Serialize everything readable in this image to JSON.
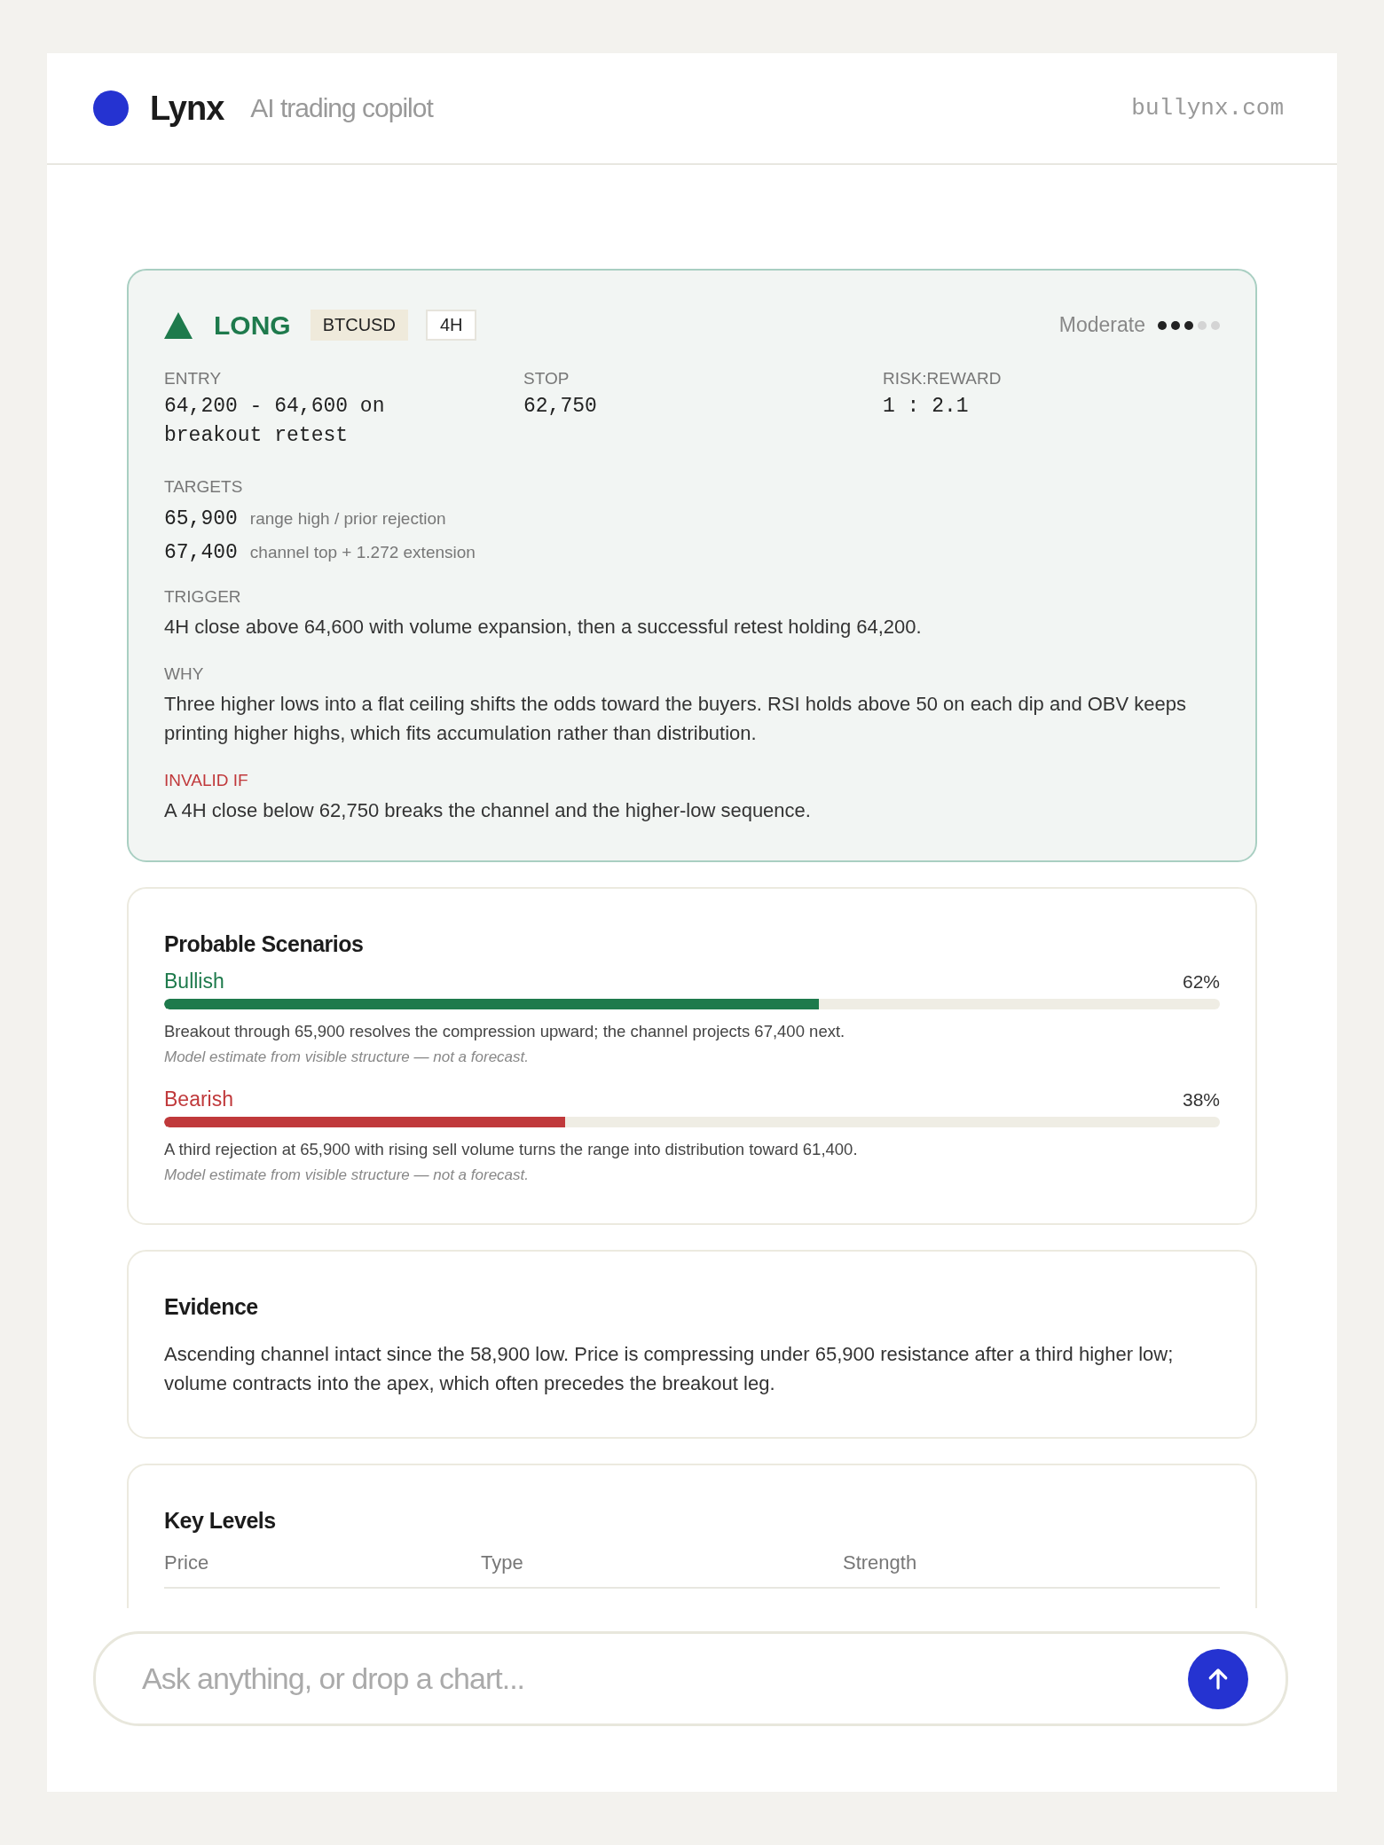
{
  "header": {
    "brand": "Lynx",
    "tagline": "AI trading copilot",
    "domain": "bullynx.com"
  },
  "signal": {
    "direction": "LONG",
    "kind": "long",
    "symbol": "BTCUSD",
    "timeframe": "4H",
    "confidence": {
      "label": "Moderate",
      "stars": 3
    },
    "metrics": [
      {
        "label": "ENTRY",
        "value": "64,200 - 64,600 on breakout retest"
      },
      {
        "label": "STOP",
        "value": "62,750"
      },
      {
        "label": "RISK:REWARD",
        "value": "1 : 2.1"
      }
    ],
    "targets_label": "TARGETS",
    "targets": [
      {
        "price": "65,900",
        "note": "range high / prior rejection"
      },
      {
        "price": "67,400",
        "note": "channel top + 1.272 extension"
      }
    ],
    "sections": [
      {
        "label": "TRIGGER",
        "kind": "normal",
        "text": "4H close above 64,600 with volume expansion, then a successful retest holding 64,200."
      },
      {
        "label": "WHY",
        "kind": "normal",
        "text": "Three higher lows into a flat ceiling shifts the odds toward the buyers. RSI holds above 50 on each dip and OBV keeps printing higher highs, which fits accumulation rather than distribution."
      },
      {
        "label": "INVALID IF",
        "kind": "warning",
        "text": "A 4H close below 62,750 breaks the channel and the higher-low sequence."
      }
    ]
  },
  "scenarios": {
    "title": "Probable Scenarios",
    "items": [
      {
        "name": "Bullish",
        "kind": "bull",
        "percent": "62%",
        "level": 0.62,
        "text": "Breakout through 65,900 resolves the compression upward; the channel projects 67,400 next.",
        "note": "Model estimate from visible structure — not a forecast."
      },
      {
        "name": "Bearish",
        "kind": "bear",
        "percent": "38%",
        "level": 0.38,
        "text": "A third rejection at 65,900 with rising sell volume turns the range into distribution toward 61,400.",
        "note": "Model estimate from visible structure — not a forecast."
      }
    ]
  },
  "evidence": {
    "title": "Evidence",
    "text": "Ascending channel intact since the 58,900 low. Price is compressing under 65,900 resistance after a third higher low; volume contracts into the apex, which often precedes the breakout leg."
  },
  "key_levels": {
    "title": "Key Levels",
    "columns": [
      "Price",
      "Type",
      "Strength"
    ]
  },
  "composer": {
    "placeholder": "Ask anything, or drop a chart..."
  }
}
